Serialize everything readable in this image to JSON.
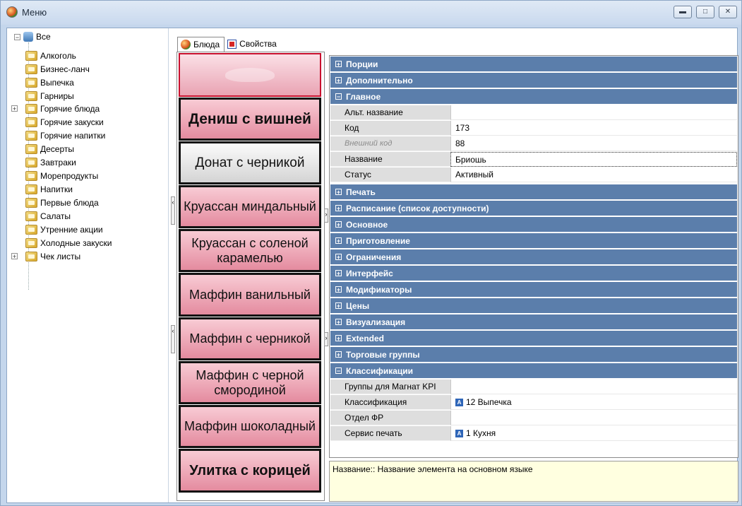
{
  "window": {
    "title": "Меню"
  },
  "tree": {
    "root": "Все",
    "items": [
      {
        "label": "Алкоголь",
        "expandable": false
      },
      {
        "label": "Бизнес-ланч",
        "expandable": false
      },
      {
        "label": "Выпечка",
        "expandable": false
      },
      {
        "label": "Гарниры",
        "expandable": false
      },
      {
        "label": "Горячие блюда",
        "expandable": true
      },
      {
        "label": "Горячие закуски",
        "expandable": false
      },
      {
        "label": "Горячие напитки",
        "expandable": false
      },
      {
        "label": "Десерты",
        "expandable": false
      },
      {
        "label": "Завтраки",
        "expandable": false
      },
      {
        "label": "Морепродукты",
        "expandable": false
      },
      {
        "label": "Напитки",
        "expandable": false
      },
      {
        "label": "Первые блюда",
        "expandable": false
      },
      {
        "label": "Салаты",
        "expandable": false
      },
      {
        "label": "Утренние акции",
        "expandable": false
      },
      {
        "label": "Холодные закуски",
        "expandable": false
      },
      {
        "label": "Чек листы",
        "expandable": true
      }
    ]
  },
  "tabs": [
    {
      "label": "Блюда"
    },
    {
      "label": "Свойства"
    }
  ],
  "dishes": [
    {
      "label": "",
      "style": "selected"
    },
    {
      "label": "Дениш с вишней",
      "style": "bold"
    },
    {
      "label": "Донат с черникой",
      "style": "grey"
    },
    {
      "label": "Круассан миндальный",
      "style": "normal"
    },
    {
      "label": "Круассан с соленой карамелью",
      "style": "normal"
    },
    {
      "label": "Маффин ванильный",
      "style": "normal"
    },
    {
      "label": "Маффин с черникой",
      "style": "normal"
    },
    {
      "label": "Маффин с черной смородиной",
      "style": "normal"
    },
    {
      "label": "Маффин шоколадный",
      "style": "normal"
    },
    {
      "label": "Улитка с корицей",
      "style": "bold"
    }
  ],
  "properties": {
    "cats": {
      "portions": "Порции",
      "extra": "Дополнительно",
      "main": "Главное",
      "print": "Печать",
      "schedule": "Расписание (список доступности)",
      "basic": "Основное",
      "cooking": "Приготовление",
      "limits": "Ограничения",
      "interface": "Интерфейс",
      "modifiers": "Модификаторы",
      "prices": "Цены",
      "visual": "Визуализация",
      "extended": "Extended",
      "trade": "Торговые группы",
      "classif": "Классификации"
    },
    "main_rows": {
      "alt_name_label": "Альт. название",
      "alt_name_value": "",
      "code_label": "Код",
      "code_value": "173",
      "ext_code_label": "Внешний код",
      "ext_code_value": "88",
      "name_label": "Название",
      "name_value": "Бриошь",
      "status_label": "Статус",
      "status_value": "Активный"
    },
    "classif_rows": {
      "kpi_label": "Группы для Магнат KPI",
      "kpi_value": "",
      "class_label": "Классификация",
      "class_value": "12 Выпечка",
      "dept_label": "Отдел ФР",
      "dept_value": "",
      "service_label": "Сервис печать",
      "service_value": "1 Кухня"
    }
  },
  "description": "Название:: Название элемента на основном языке"
}
